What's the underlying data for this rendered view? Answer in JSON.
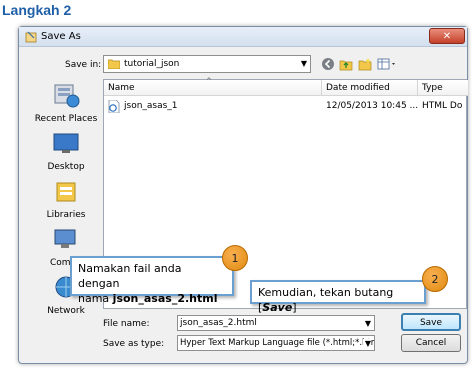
{
  "heading": "Langkah 2",
  "dialog": {
    "title": "Save As",
    "close_label": "✕",
    "save_in_label": "Save in:",
    "save_in_value": "tutorial_json",
    "places": [
      "Recent Places",
      "Desktop",
      "Libraries",
      "Compu",
      "Network"
    ],
    "columns": [
      "Name",
      "Date modified",
      "Type"
    ],
    "files": [
      {
        "name": "json_asas_1",
        "date": "12/05/2013 10:45 ...",
        "type": "HTML Do"
      }
    ],
    "file_name_label": "File name:",
    "file_name_value": "json_asas_2.html",
    "save_as_type_label": "Save as type:",
    "save_as_type_value": "Hyper Text Markup Language file (*.html;*.htm;*",
    "save_button": "Save",
    "cancel_button": "Cancel"
  },
  "callouts": {
    "one": {
      "number": "1",
      "line1": "Namakan fail anda dengan",
      "line2_prefix": "nama ",
      "line2_bold": "json_asas_2.html"
    },
    "two": {
      "number": "2",
      "text_prefix": "Kemudian, tekan butang [",
      "text_bold": "Save",
      "text_suffix": "]"
    }
  },
  "colors": {
    "heading": "#1f5fa8",
    "callout_border": "#6a9fd0",
    "badge": "#f0a030"
  }
}
